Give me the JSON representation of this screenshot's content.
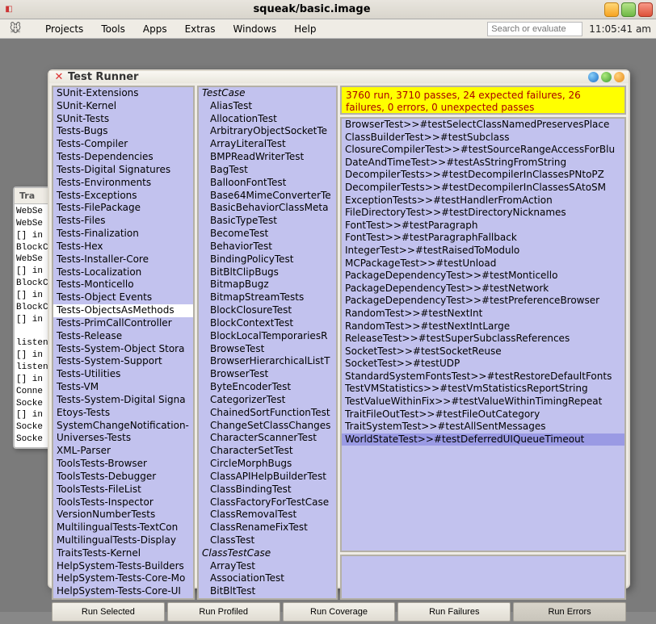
{
  "window": {
    "title": "squeak/basic.image"
  },
  "menubar": {
    "items": [
      "Projects",
      "Tools",
      "Apps",
      "Extras",
      "Windows",
      "Help"
    ],
    "search_placeholder": "Search or evaluate",
    "clock": "11:05:41 am"
  },
  "transcript": {
    "title": "Tra",
    "lines": [
      "WebSe",
      "WebSe",
      "[] in W",
      "BlockC",
      "WebSe",
      "[] in []",
      "BlockC",
      "[] in W",
      "BlockC",
      "[] in Bl",
      "",
      "listene",
      "[] in []",
      "listene",
      "[] in So",
      "Conne",
      "Socke",
      "[] in So",
      "Socke",
      "Socke"
    ]
  },
  "test_runner": {
    "title": "Test Runner",
    "categories": [
      "SUnit-Extensions",
      "SUnit-Kernel",
      "SUnit-Tests",
      "Tests-Bugs",
      "Tests-Compiler",
      "Tests-Dependencies",
      "Tests-Digital Signatures",
      "Tests-Environments",
      "Tests-Exceptions",
      "Tests-FilePackage",
      "Tests-Files",
      "Tests-Finalization",
      "Tests-Hex",
      "Tests-Installer-Core",
      "Tests-Localization",
      "Tests-Monticello",
      "Tests-Object Events",
      "Tests-ObjectsAsMethods",
      "Tests-PrimCallController",
      "Tests-Release",
      "Tests-System-Object Stora",
      "Tests-System-Support",
      "Tests-Utilities",
      "Tests-VM",
      "Tests-System-Digital Signa",
      "Etoys-Tests",
      "SystemChangeNotification-",
      "Universes-Tests",
      "XML-Parser",
      "ToolsTests-Browser",
      "ToolsTests-Debugger",
      "ToolsTests-FileList",
      "ToolsTests-Inspector",
      "VersionNumberTests",
      "MultilingualTests-TextCon",
      "MultilingualTests-Display",
      "TraitsTests-Kernel",
      "HelpSystem-Tests-Builders",
      "HelpSystem-Tests-Core-Mo",
      "HelpSystem-Tests-Core-UI"
    ],
    "selected_category": "Tests-ObjectsAsMethods",
    "class_groups": [
      {
        "header": "TestCase",
        "items": [
          "AliasTest",
          "AllocationTest",
          "ArbitraryObjectSocketTe",
          "ArrayLiteralTest",
          "BMPReadWriterTest",
          "BagTest",
          "BalloonFontTest",
          "Base64MimeConverterTe",
          "BasicBehaviorClassMeta",
          "BasicTypeTest",
          "BecomeTest",
          "BehaviorTest",
          "BindingPolicyTest",
          "BitBltClipBugs",
          "BitmapBugz",
          "BitmapStreamTests",
          "BlockClosureTest",
          "BlockContextTest",
          "BlockLocalTemporariesR",
          "BrowseTest",
          "BrowserHierarchicalListT",
          "BrowserTest",
          "ByteEncoderTest",
          "CategorizerTest",
          "ChainedSortFunctionTest",
          "ChangeSetClassChanges",
          "CharacterScannerTest",
          "CharacterSetTest",
          "CircleMorphBugs",
          "ClassAPIHelpBuilderTest",
          "ClassBindingTest",
          "ClassFactoryForTestCase",
          "ClassRemovalTest",
          "ClassRenameFixTest",
          "ClassTest"
        ]
      },
      {
        "header": "ClassTestCase",
        "items": [
          "ArrayTest",
          "AssociationTest",
          "BitBltTest"
        ]
      }
    ],
    "status": "3760 run, 3710 passes, 24 expected failures, 26 failures, 0 errors, 0 unexpected passes",
    "results": [
      "BrowserTest>>#testSelectClassNamedPreservesPlace",
      "ClassBuilderTest>>#testSubclass",
      "ClosureCompilerTest>>#testSourceRangeAccessForBlu",
      "DateAndTimeTest>>#testAsStringFromString",
      "DecompilerTests>>#testDecompilerInClassesPNtoPZ",
      "DecompilerTests>>#testDecompilerInClassesSAtoSM",
      "ExceptionTests>>#testHandlerFromAction",
      "FileDirectoryTest>>#testDirectoryNicknames",
      "FontTest>>#testParagraph",
      "FontTest>>#testParagraphFallback",
      "IntegerTest>>#testRaisedToModulo",
      "MCPackageTest>>#testUnload",
      "PackageDependencyTest>>#testMonticello",
      "PackageDependencyTest>>#testNetwork",
      "PackageDependencyTest>>#testPreferenceBrowser",
      "RandomTest>>#testNextInt",
      "RandomTest>>#testNextIntLarge",
      "ReleaseTest>>#testSuperSubclassReferences",
      "SocketTest>>#testSocketReuse",
      "SocketTest>>#testUDP",
      "StandardSystemFontsTest>>#testRestoreDefaultFonts",
      "TestVMStatistics>>#testVmStatisticsReportString",
      "TestValueWithinFix>>#testValueWithinTimingRepeat",
      "TraitFileOutTest>>#testFileOutCategory",
      "TraitSystemTest>>#testAllSentMessages",
      "WorldStateTest>>#testDeferredUIQueueTimeout"
    ],
    "selected_result": "WorldStateTest>>#testDeferredUIQueueTimeout",
    "buttons": {
      "run_selected": "Run Selected",
      "run_profiled": "Run Profiled",
      "run_coverage": "Run Coverage",
      "run_failures": "Run Failures",
      "run_errors": "Run Errors"
    }
  }
}
